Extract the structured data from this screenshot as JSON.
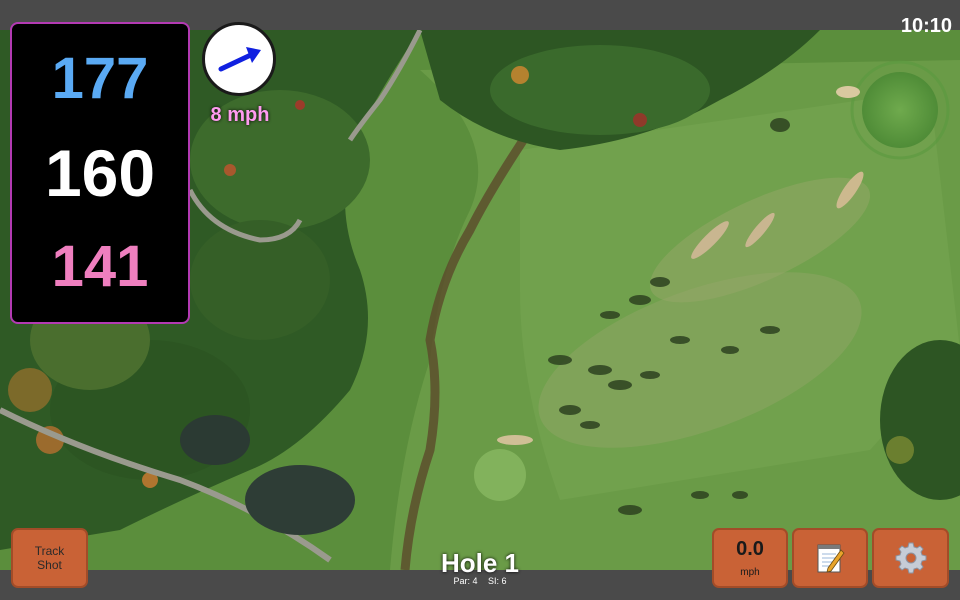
{
  "clock": "10:10",
  "yardage": {
    "back": "177",
    "middle": "160",
    "front": "141"
  },
  "wind": {
    "speed_text": "8 mph",
    "direction_icon": "arrow-icon"
  },
  "buttons": {
    "track_shot_line1": "Track",
    "track_shot_line2": "Shot",
    "shot_speed_value": "0.0",
    "shot_speed_unit": "mph",
    "notes_icon": "notepad-icon",
    "settings_icon": "gear-icon"
  },
  "hole": {
    "title": "Hole 1",
    "par": "Par: 4",
    "si": "SI: 6"
  },
  "colors": {
    "back_yardage": "#5aaaf4",
    "middle_yardage": "#ffffff",
    "front_yardage": "#ef7fbf",
    "panel_border": "#b33ab3",
    "button": "#c96236",
    "wind_text": "#ff9bf0"
  }
}
